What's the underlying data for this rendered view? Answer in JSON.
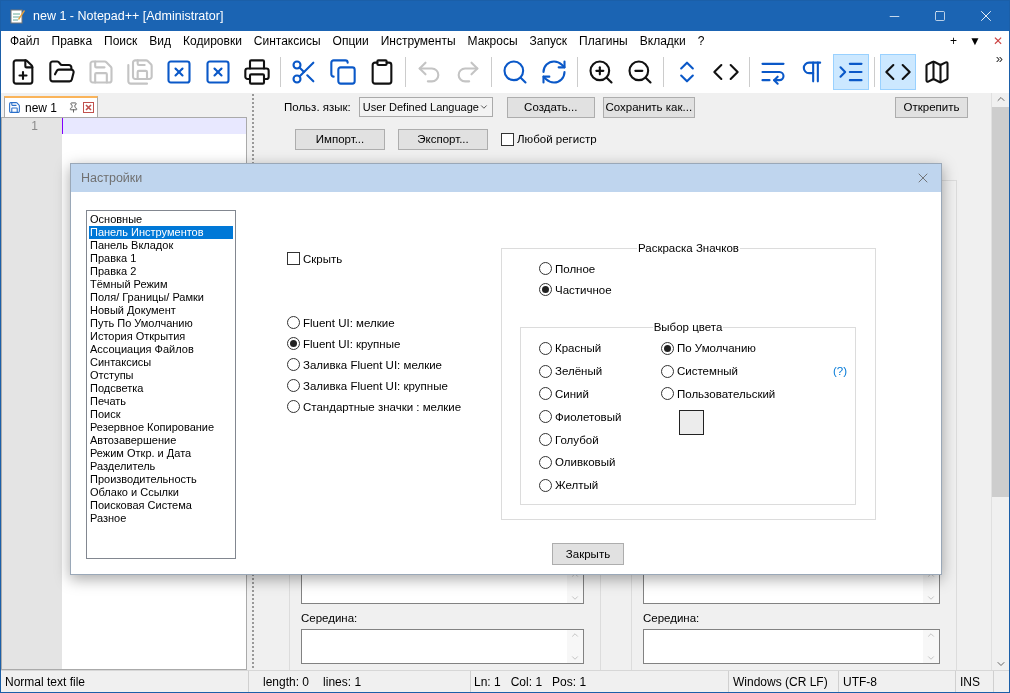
{
  "window": {
    "title": "new 1 - Notepad++ [Administrator]"
  },
  "menu": [
    "Файл",
    "Правка",
    "Поиск",
    "Вид",
    "Кодировки",
    "Синтаксисы",
    "Опции",
    "Инструменты",
    "Макросы",
    "Запуск",
    "Плагины",
    "Вкладки",
    "?"
  ],
  "menu_extras": [
    "+",
    "▼",
    "✕"
  ],
  "toolbar": [
    {
      "kind": "new",
      "enabled": true,
      "selected": false
    },
    {
      "kind": "open",
      "enabled": true,
      "selected": false
    },
    {
      "kind": "save",
      "enabled": false,
      "selected": false
    },
    {
      "kind": "save_all",
      "enabled": false,
      "selected": false
    },
    {
      "kind": "close",
      "enabled": true,
      "selected": false
    },
    {
      "kind": "close_all",
      "enabled": true,
      "selected": false
    },
    {
      "kind": "print",
      "enabled": true,
      "selected": false
    },
    {
      "kind": "separator"
    },
    {
      "kind": "cut",
      "enabled": true,
      "selected": false
    },
    {
      "kind": "copy",
      "enabled": true,
      "selected": false
    },
    {
      "kind": "paste",
      "enabled": true,
      "selected": false
    },
    {
      "kind": "separator"
    },
    {
      "kind": "undo",
      "enabled": false,
      "selected": false
    },
    {
      "kind": "redo",
      "enabled": false,
      "selected": false
    },
    {
      "kind": "separator"
    },
    {
      "kind": "find",
      "enabled": true,
      "selected": false
    },
    {
      "kind": "replace",
      "enabled": true,
      "selected": false
    },
    {
      "kind": "separator"
    },
    {
      "kind": "zoom_in",
      "enabled": true,
      "selected": false
    },
    {
      "kind": "zoom_out",
      "enabled": true,
      "selected": false
    },
    {
      "kind": "separator"
    },
    {
      "kind": "sync_v",
      "enabled": true,
      "selected": false
    },
    {
      "kind": "sync_h",
      "enabled": true,
      "selected": false
    },
    {
      "kind": "separator"
    },
    {
      "kind": "wrap",
      "enabled": true,
      "selected": false
    },
    {
      "kind": "pilcrow",
      "enabled": true,
      "selected": false
    },
    {
      "kind": "indent",
      "enabled": true,
      "selected": true
    },
    {
      "kind": "separator"
    },
    {
      "kind": "code",
      "enabled": true,
      "selected": true
    },
    {
      "kind": "map",
      "enabled": true,
      "selected": false
    }
  ],
  "toolbar_overflow": "»",
  "tabs": [
    {
      "label": "new 1",
      "selected": true
    }
  ],
  "editor": {
    "line_numbers": [
      "1"
    ]
  },
  "udl_panel": {
    "language_label": "Польз. язык:",
    "language_value": "User Defined Language",
    "create_button": "Создать...",
    "save_as_button": "Сохранить как...",
    "dock_button": "Открепить",
    "import_button": "Импорт...",
    "export_button": "Экспорт...",
    "ignore_case": {
      "label": "Любой регистр",
      "checked": false
    },
    "columns": [
      {
        "label": "Середина:"
      },
      {
        "label": "Середина:"
      }
    ]
  },
  "dialog": {
    "title": "Настройки",
    "categories": [
      {
        "label": "Основные",
        "selected": false
      },
      {
        "label": "Панель Инструментов",
        "selected": true
      },
      {
        "label": "Панель Вкладок",
        "selected": false
      },
      {
        "label": "Правка 1",
        "selected": false
      },
      {
        "label": "Правка 2",
        "selected": false
      },
      {
        "label": "Тёмный Режим",
        "selected": false
      },
      {
        "label": "Поля/ Границы/ Рамки",
        "selected": false
      },
      {
        "label": "Новый Документ",
        "selected": false
      },
      {
        "label": "Путь По Умолчанию",
        "selected": false
      },
      {
        "label": "История Открытия",
        "selected": false
      },
      {
        "label": "Ассоциация Файлов",
        "selected": false
      },
      {
        "label": "Синтаксисы",
        "selected": false
      },
      {
        "label": "Отступы",
        "selected": false
      },
      {
        "label": "Подсветка",
        "selected": false
      },
      {
        "label": "Печать",
        "selected": false
      },
      {
        "label": "Поиск",
        "selected": false
      },
      {
        "label": "Резервное Копирование",
        "selected": false
      },
      {
        "label": "Автозавершение",
        "selected": false
      },
      {
        "label": "Режим Откр. и Дата",
        "selected": false
      },
      {
        "label": "Разделитель",
        "selected": false
      },
      {
        "label": "Производительность",
        "selected": false
      },
      {
        "label": "Облако и Ссылки",
        "selected": false
      },
      {
        "label": "Поисковая Система",
        "selected": false
      },
      {
        "label": "Разное",
        "selected": false
      }
    ],
    "hide": {
      "label": "Скрыть",
      "checked": false
    },
    "icon_sets": [
      {
        "label": "Fluent UI: мелкие",
        "selected": false
      },
      {
        "label": "Fluent UI: крупные",
        "selected": true
      },
      {
        "label": "Заливка Fluent UI: мелкие",
        "selected": false
      },
      {
        "label": "Заливка Fluent UI: крупные",
        "selected": false
      },
      {
        "label": "Стандартные значки : мелкие",
        "selected": false
      }
    ],
    "coloring": {
      "title": "Раскраска Значков",
      "modes": [
        {
          "label": "Полное",
          "selected": false
        },
        {
          "label": "Частичное",
          "selected": true
        }
      ],
      "color_choice": {
        "title": "Выбор цвета",
        "colors": [
          {
            "label": "Красный",
            "selected": false
          },
          {
            "label": "Зелёный",
            "selected": false
          },
          {
            "label": "Синий",
            "selected": false
          },
          {
            "label": "Фиолетовый",
            "selected": false
          },
          {
            "label": "Голубой",
            "selected": false
          },
          {
            "label": "Оливковый",
            "selected": false
          },
          {
            "label": "Желтый",
            "selected": false
          }
        ],
        "others": [
          {
            "label": "По Умолчанию",
            "selected": true
          },
          {
            "label": "Системный",
            "selected": false
          },
          {
            "label": "Пользовательский",
            "selected": false
          }
        ],
        "help": "(?)"
      }
    },
    "close_button": "Закрыть"
  },
  "status_bar": {
    "file_type": "Normal text file",
    "length": "length: 0",
    "lines": "lines: 1",
    "ln": "Ln: 1",
    "col": "Col: 1",
    "pos": "Pos: 1",
    "eol": "Windows (CR LF)",
    "encoding": "UTF-8",
    "mode": "INS"
  }
}
